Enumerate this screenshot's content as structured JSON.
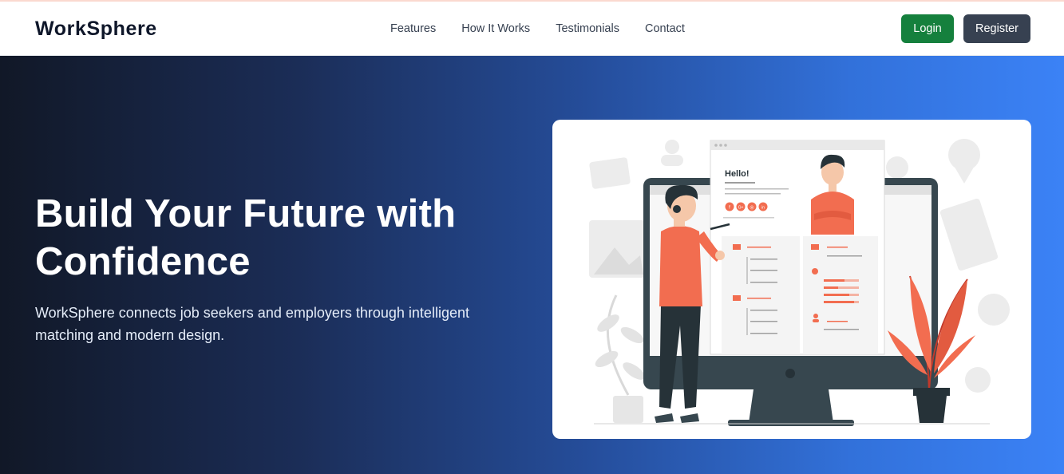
{
  "brand": {
    "name": "WorkSphere"
  },
  "nav": {
    "links": [
      {
        "label": "Features"
      },
      {
        "label": "How It Works"
      },
      {
        "label": "Testimonials"
      },
      {
        "label": "Contact"
      }
    ]
  },
  "auth": {
    "login_label": "Login",
    "register_label": "Register"
  },
  "hero": {
    "title": "Build Your Future with Confidence",
    "subtitle": "WorkSphere connects job seekers and employers through intelligent matching and modern design.",
    "illustration": {
      "greeting": "Hello!",
      "social_icons": [
        "f",
        "G+",
        "◎",
        "in"
      ]
    }
  },
  "colors": {
    "brand_text": "#0f172a",
    "login_button": "#15803d",
    "register_button": "#374151",
    "hero_gradient_start": "#111827",
    "hero_gradient_end": "#3b82f6",
    "illustration_accent": "#f26d50",
    "illustration_dark": "#37474f"
  }
}
